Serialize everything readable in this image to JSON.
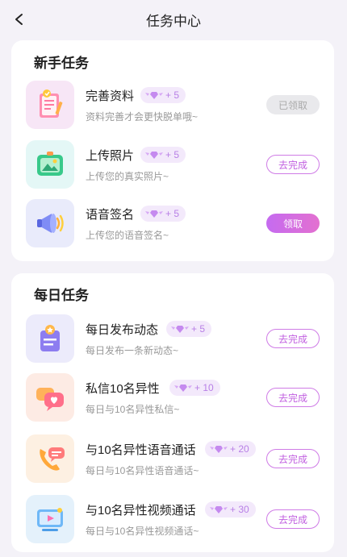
{
  "header": {
    "title": "任务中心",
    "back_icon": "chevron-left-icon"
  },
  "sections": [
    {
      "title": "新手任务",
      "tasks": [
        {
          "name": "完善资料",
          "reward": "+ 5",
          "desc": "资料完善才会更快脱单哦~",
          "button": "已领取",
          "state": "done",
          "icon": "profile-document-icon",
          "icon_bg": "#f7e6f6"
        },
        {
          "name": "上传照片",
          "reward": "+ 5",
          "desc": "上传您的真实照片~",
          "button": "去完成",
          "state": "go",
          "icon": "photo-icon",
          "icon_bg": "#e4f7f6"
        },
        {
          "name": "语音签名",
          "reward": "+ 5",
          "desc": "上传您的语音签名~",
          "button": "领取",
          "state": "claim",
          "icon": "megaphone-icon",
          "icon_bg": "#e9ebfb"
        }
      ]
    },
    {
      "title": "每日任务",
      "tasks": [
        {
          "name": "每日发布动态",
          "reward": "+ 5",
          "desc": "每日发布一条新动态~",
          "button": "去完成",
          "state": "go",
          "icon": "post-icon",
          "icon_bg": "#ecebfb"
        },
        {
          "name": "私信10名异性",
          "reward": "+ 10",
          "desc": "每日与10名异性私信~",
          "button": "去完成",
          "state": "go",
          "icon": "chat-heart-icon",
          "icon_bg": "#fdebe4"
        },
        {
          "name": "与10名异性语音通话",
          "reward": "+ 20",
          "desc": "每日与10名异性语音通话~",
          "button": "去完成",
          "state": "go",
          "icon": "phone-call-icon",
          "icon_bg": "#fdf0e2"
        },
        {
          "name": "与10名异性视频通话",
          "reward": "+ 30",
          "desc": "每日与10名异性视频通话~",
          "button": "去完成",
          "state": "go",
          "icon": "video-call-icon",
          "icon_bg": "#e4f1fb"
        }
      ]
    }
  ],
  "colors": {
    "accent": "#c15fe0",
    "reward_bg": "#f3e9fb",
    "reward_text": "#b880e6"
  }
}
